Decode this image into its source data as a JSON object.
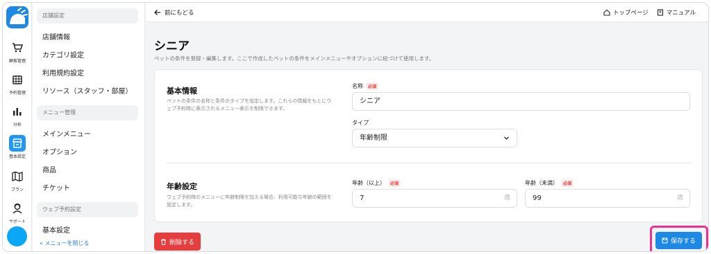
{
  "rail": {
    "items": [
      {
        "label": "顧客管理",
        "icon": "cart-icon"
      },
      {
        "label": "予約管理",
        "icon": "calendar-icon"
      },
      {
        "label": "分析",
        "icon": "bar-chart-icon"
      },
      {
        "label": "基本設定",
        "icon": "store-icon",
        "active": true
      },
      {
        "label": "プラン",
        "icon": "map-icon"
      },
      {
        "label": "サポート",
        "icon": "support-icon"
      }
    ]
  },
  "menu": {
    "section_store": "店舗設定",
    "store_items": [
      "店舗情報",
      "カテゴリ設定",
      "利用規約設定",
      "リソース（スタッフ・部屋）"
    ],
    "section_menu": "メニュー管理",
    "menu_items": [
      "メインメニュー",
      "オプション",
      "商品",
      "チケット"
    ],
    "section_web": "ウェブ予約設定",
    "web_items": [
      "基本設定"
    ],
    "close_label": "« メニューを閉じる"
  },
  "topbar": {
    "back_label": "前にもどる",
    "top_page_label": "トップページ",
    "manual_label": "マニュアル"
  },
  "page": {
    "title": "シニア",
    "description": "ペットの条件を登録・編集します。ここで作成したペットの条件をメインメニューやオプションに紐づけて使用します。"
  },
  "basic": {
    "title": "基本情報",
    "description": "ペットの条件の名称と条件のタイプを設定します。これらの情報をもとにウェブ予約時に表示されるメニュー表示を制限できます。",
    "name_label": "名称",
    "name_value": "シニア",
    "type_label": "タイプ",
    "type_value": "年齢制限"
  },
  "age": {
    "title": "年齢設定",
    "description": "ウェブ予約時のメニューに年齢制限を加える場合、利用可能な年齢の範囲を設定します。",
    "min_label": "年齢（以上）",
    "min_value": "7",
    "max_label": "年齢（未満）",
    "max_value": "99",
    "unit": "歳"
  },
  "required_badge": "必須",
  "actions": {
    "delete_label": "削除する",
    "save_label": "保存する"
  },
  "colors": {
    "accent": "#1e88e5",
    "danger": "#e53e3e",
    "highlight": "#f0318b"
  }
}
